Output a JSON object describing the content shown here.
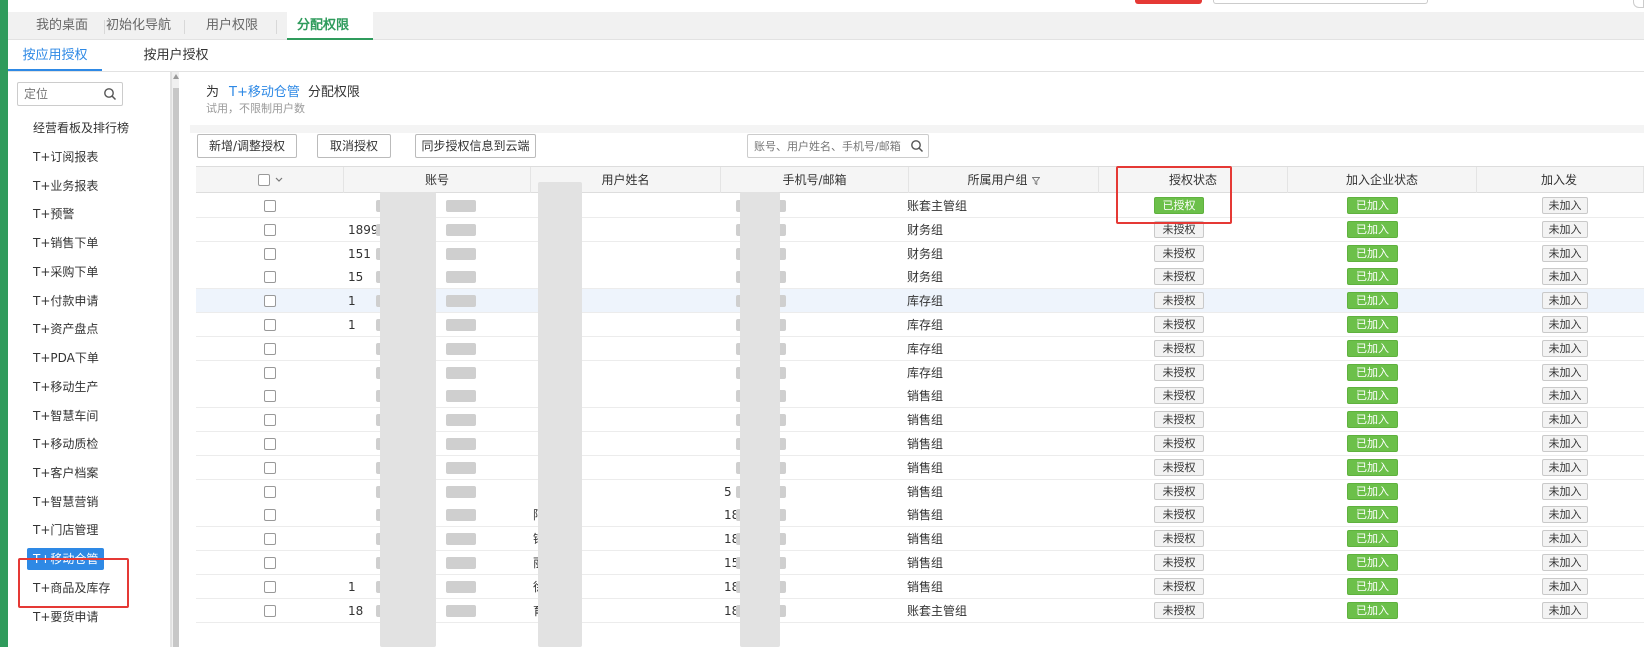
{
  "tabs": [
    {
      "label": "我的桌面"
    },
    {
      "label": "初始化导航"
    },
    {
      "label": "用户权限"
    },
    {
      "label": "分配权限",
      "close": "✕"
    }
  ],
  "subtabs": [
    {
      "label": "按应用授权"
    },
    {
      "label": "按用户授权"
    }
  ],
  "sidebar": {
    "search_placeholder": "定位",
    "items": [
      {
        "label": "经营看板及排行榜"
      },
      {
        "label": "T+订阅报表"
      },
      {
        "label": "T+业务报表"
      },
      {
        "label": "T+预警"
      },
      {
        "label": "T+销售下单"
      },
      {
        "label": "T+采购下单"
      },
      {
        "label": "T+付款申请"
      },
      {
        "label": "T+资产盘点"
      },
      {
        "label": "T+PDA下单"
      },
      {
        "label": "T+移动生产"
      },
      {
        "label": "T+智慧车间"
      },
      {
        "label": "T+移动质检"
      },
      {
        "label": "T+客户档案"
      },
      {
        "label": "T+智慧营销"
      },
      {
        "label": "T+门店管理"
      },
      {
        "label": "T+移动仓管"
      },
      {
        "label": "T+商品及库存"
      },
      {
        "label": "T+要货申请"
      }
    ]
  },
  "header": {
    "prefix": "为",
    "app_name": "T+移动仓管",
    "suffix": "分配权限",
    "subtitle": "试用，不限制用户数"
  },
  "toolbar": {
    "add_label": "新增/调整授权",
    "cancel_label": "取消授权",
    "sync_label": "同步授权信息到云端",
    "search_placeholder": "账号、用户姓名、手机号/邮箱"
  },
  "table": {
    "columns": [
      "",
      "账号",
      "用户姓名",
      "手机号/邮箱",
      "所属用户组",
      "授权状态",
      "加入企业状态",
      "加入发"
    ],
    "rows": [
      {
        "account": "",
        "name": "",
        "phone": "",
        "group": "账套主管组",
        "auth": "已授权",
        "join": "已加入",
        "join2": "未加入"
      },
      {
        "account": "1899",
        "name": "",
        "phone": "",
        "group": "财务组",
        "auth": "未授权",
        "join": "已加入",
        "join2": "未加入"
      },
      {
        "account": "151",
        "name": "",
        "phone": "",
        "group": "财务组",
        "auth": "未授权",
        "join": "已加入",
        "join2": "未加入"
      },
      {
        "account": "15",
        "name": "",
        "phone": "",
        "group": "财务组",
        "auth": "未授权",
        "join": "已加入",
        "join2": "未加入"
      },
      {
        "account": "1",
        "name": "",
        "phone": "",
        "group": "库存组",
        "auth": "未授权",
        "join": "已加入",
        "join2": "未加入"
      },
      {
        "account": "1",
        "name": "",
        "phone": "",
        "group": "库存组",
        "auth": "未授权",
        "join": "已加入",
        "join2": "未加入"
      },
      {
        "account": "",
        "name": "",
        "phone": "",
        "group": "库存组",
        "auth": "未授权",
        "join": "已加入",
        "join2": "未加入"
      },
      {
        "account": "",
        "name": "",
        "phone": "",
        "group": "库存组",
        "auth": "未授权",
        "join": "已加入",
        "join2": "未加入"
      },
      {
        "account": "",
        "name": "",
        "phone": "",
        "group": "销售组",
        "auth": "未授权",
        "join": "已加入",
        "join2": "未加入"
      },
      {
        "account": "",
        "name": "",
        "phone": "",
        "group": "销售组",
        "auth": "未授权",
        "join": "已加入",
        "join2": "未加入"
      },
      {
        "account": "",
        "name": "",
        "phone": "",
        "group": "销售组",
        "auth": "未授权",
        "join": "已加入",
        "join2": "未加入"
      },
      {
        "account": "",
        "name": "",
        "phone": "",
        "group": "销售组",
        "auth": "未授权",
        "join": "已加入",
        "join2": "未加入"
      },
      {
        "account": "",
        "name": "",
        "phone": "5",
        "group": "销售组",
        "auth": "未授权",
        "join": "已加入",
        "join2": "未加入"
      },
      {
        "account": "",
        "name": "阿",
        "phone": "18",
        "group": "销售组",
        "auth": "未授权",
        "join": "已加入",
        "join2": "未加入"
      },
      {
        "account": "",
        "name": "锋",
        "phone": "18",
        "group": "销售组",
        "auth": "未授权",
        "join": "已加入",
        "join2": "未加入"
      },
      {
        "account": "",
        "name": "丽",
        "phone": "15",
        "group": "销售组",
        "auth": "未授权",
        "join": "已加入",
        "join2": "未加入"
      },
      {
        "account": "1",
        "name": "徐",
        "phone": "18192",
        "group": "销售组",
        "auth": "未授权",
        "join": "已加入",
        "join2": "未加入"
      },
      {
        "account": "18",
        "name": "育",
        "phone": "18",
        "group": "账套主管组",
        "auth": "未授权",
        "join": "已加入",
        "join2": "未加入"
      }
    ]
  },
  "colors": {
    "accent_blue": "#2e89e5",
    "green": "#6cc04a",
    "theme_green": "#2f9b5c",
    "highlight_red": "#e53935"
  }
}
